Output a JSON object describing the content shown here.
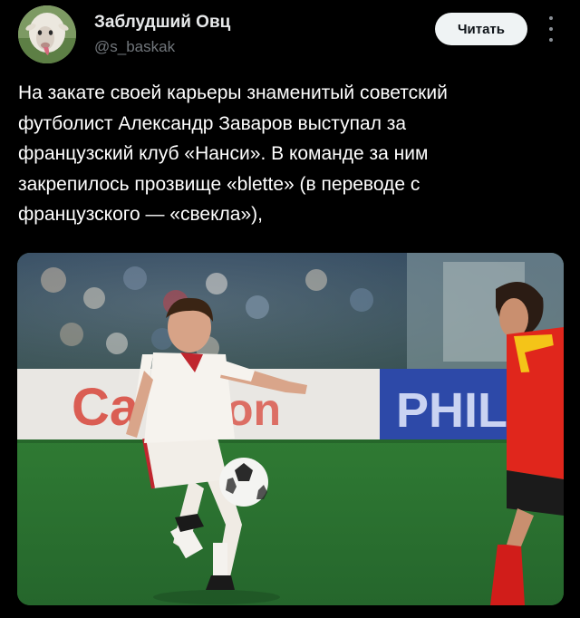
{
  "author": {
    "display_name": "Заблудший Овц",
    "handle": "@s_baskak",
    "avatar_icon": "sheep-avatar-icon"
  },
  "follow_button": {
    "label": "Читать"
  },
  "more_menu": {
    "icon": "more-vertical-icon"
  },
  "tweet": {
    "text": "На закате своей карьеры знаменитый советский\nфутболист Александр Заваров выступал за\nфранцузский клуб «Нанси». В команде за ним\nзакрепилось прозвище «blette» (в переводе с\nфранцузского — «свекла»),"
  },
  "media": {
    "ad_board_text_left": "Ca",
    "ad_board_text_middle": "on",
    "ad_board_text_right": "PHIL"
  },
  "colors": {
    "background": "#000000",
    "text_primary": "#ffffff",
    "text_secondary": "#71767b",
    "button_bg": "#eff3f4",
    "pitch_green": "#2f7a33",
    "opponent_kit": "#e0261c"
  }
}
